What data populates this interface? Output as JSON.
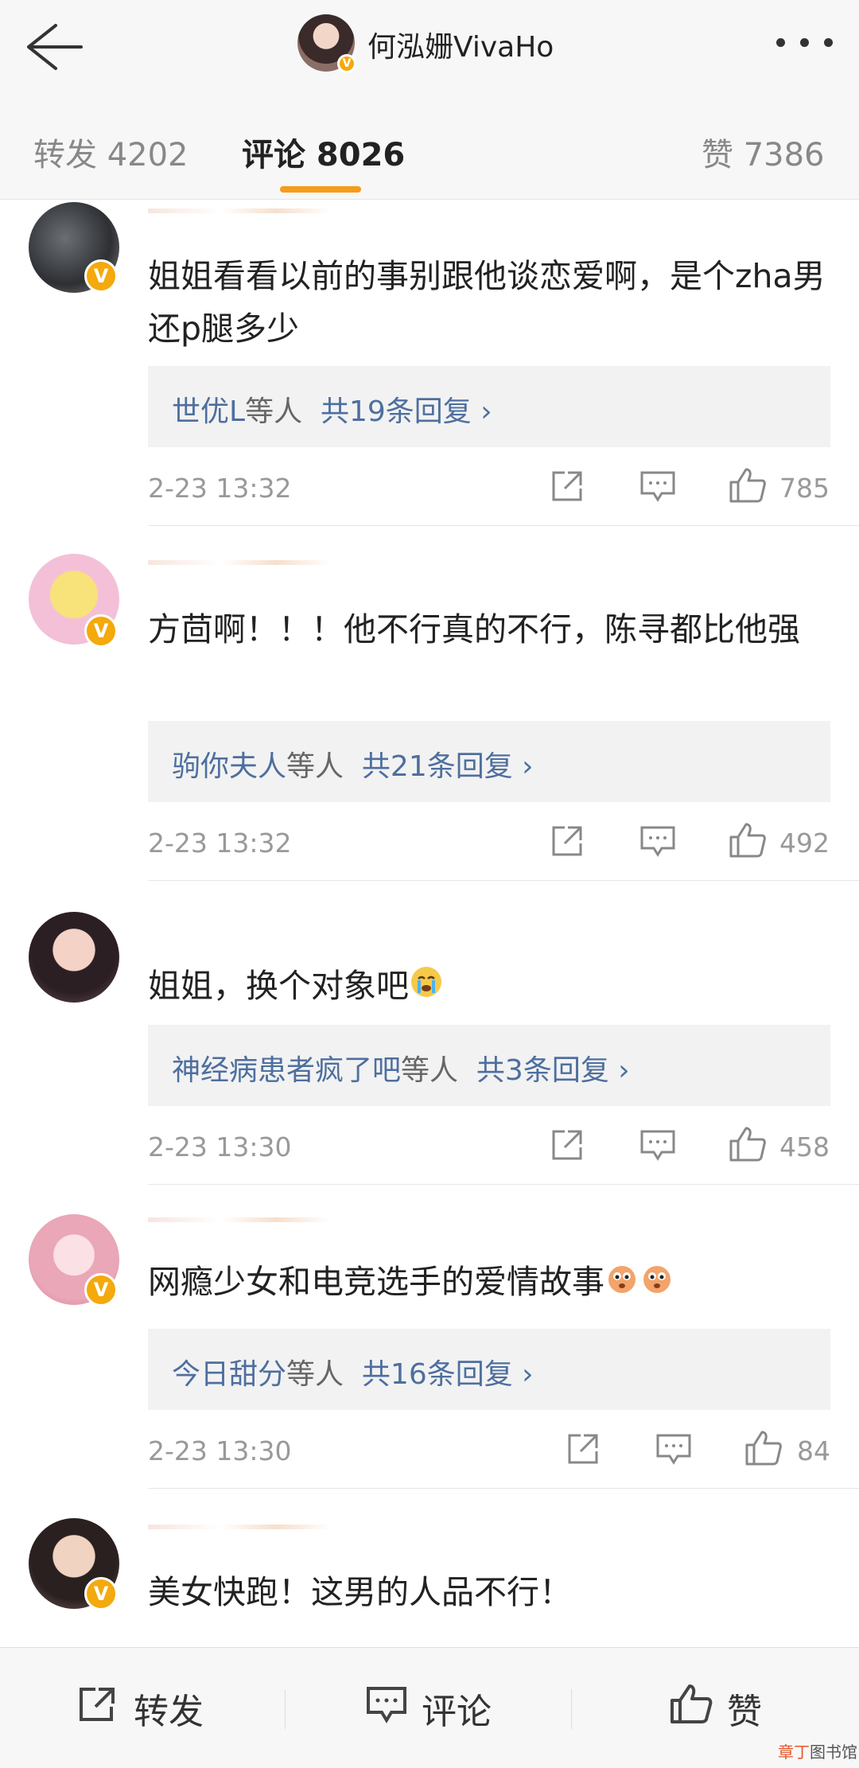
{
  "header": {
    "title": "何泓姗VivaHo",
    "badge": "V"
  },
  "tabs": {
    "repost": "转发 4202",
    "comments": "评论 8026",
    "likes": "赞 7386"
  },
  "comments": [
    {
      "text": "姐姐看看以前的事别跟他谈恋爱啊，是个zha男还p腿多少",
      "reply_users": "世优L",
      "reply_mid": "等人",
      "reply_count": "共19条回复 ›",
      "time": "2-23 13:32",
      "likes": "785"
    },
    {
      "text": "方茴啊！！！他不行真的不行，陈寻都比他强",
      "reply_users": "驹你夫人",
      "reply_mid": "等人",
      "reply_count": "共21条回复 ›",
      "time": "2-23 13:32",
      "likes": "492"
    },
    {
      "text": "姐姐，换个对象吧",
      "reply_users": "神经病患者疯了吧",
      "reply_mid": "等人",
      "reply_count": "共3条回复 ›",
      "time": "2-23 13:30",
      "likes": "458"
    },
    {
      "text": "网瘾少女和电竞选手的爱情故事",
      "reply_users": "今日甜分",
      "reply_mid": "等人",
      "reply_count": "共16条回复 ›",
      "time": "2-23 13:30",
      "likes": "84"
    },
    {
      "text": "美女快跑！这男的人品不行！"
    }
  ],
  "bottom": {
    "repost": "转发",
    "comment": "评论",
    "like": "赞"
  },
  "watermark": {
    "a": "章丁",
    "b": "图书馆"
  },
  "colors": {
    "accent": "#f59c1b",
    "link": "#4e6f9e",
    "badge": "#f4a90c"
  }
}
